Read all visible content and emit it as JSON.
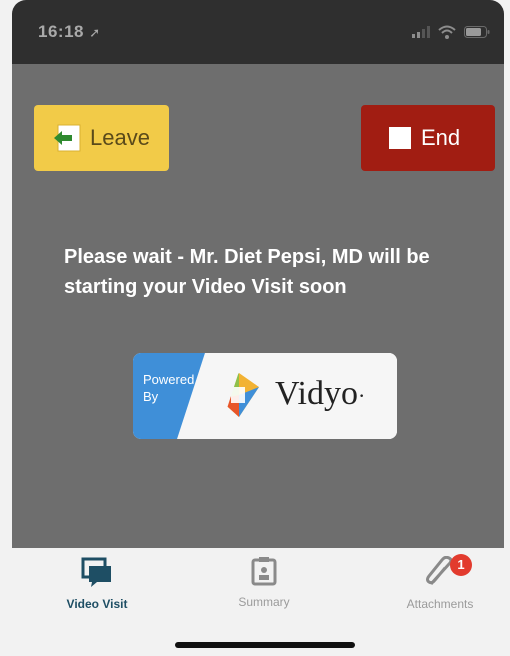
{
  "status_bar": {
    "time": "16:18",
    "icons": [
      "location-arrow-icon",
      "signal-icon",
      "wifi-icon",
      "battery-icon"
    ]
  },
  "actions": {
    "leave_label": "Leave",
    "end_label": "End"
  },
  "message": "Please wait - Mr. Diet Pepsi, MD will be starting your Video Visit soon",
  "vidyo": {
    "powered_by_line1": "Powered",
    "powered_by_line2": "By",
    "brand": "Vidyo",
    "mark": "·"
  },
  "tabs": [
    {
      "label": "Video Visit",
      "icon": "video-chat-icon",
      "active": true
    },
    {
      "label": "Summary",
      "icon": "clipboard-icon",
      "active": false
    },
    {
      "label": "Attachments",
      "icon": "paperclip-icon",
      "active": false,
      "badge": "1"
    }
  ],
  "colors": {
    "leave": "#f2cb48",
    "end": "#a11d12",
    "video_bg": "#6e6e6e",
    "active_tab": "#1e4e64",
    "badge": "#e23b2e"
  }
}
